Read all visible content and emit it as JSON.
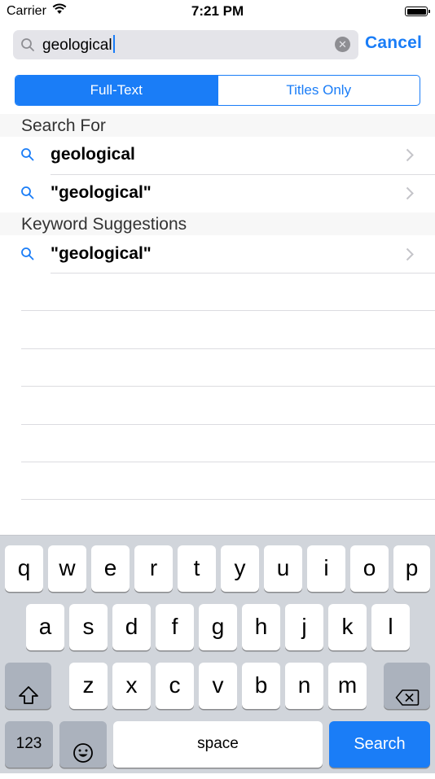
{
  "status_bar": {
    "carrier": "Carrier",
    "time": "7:21 PM"
  },
  "search": {
    "query": "geological",
    "cancel_label": "Cancel"
  },
  "segmented": {
    "options": [
      "Full-Text",
      "Titles Only"
    ],
    "selected": "Full-Text"
  },
  "sections": [
    {
      "header": "Search For",
      "rows": [
        {
          "label": "geological"
        },
        {
          "label": "\"geological\""
        }
      ]
    },
    {
      "header": "Keyword Suggestions",
      "rows": [
        {
          "label": "\"geological\""
        }
      ]
    }
  ],
  "keyboard": {
    "row1": [
      "q",
      "w",
      "e",
      "r",
      "t",
      "y",
      "u",
      "i",
      "o",
      "p"
    ],
    "row2": [
      "a",
      "s",
      "d",
      "f",
      "g",
      "h",
      "j",
      "k",
      "l"
    ],
    "row3": [
      "z",
      "x",
      "c",
      "v",
      "b",
      "n",
      "m"
    ],
    "numbers_label": "123",
    "space_label": "space",
    "search_label": "Search"
  },
  "colors": {
    "accent": "#1a7df7",
    "keyboard_bg": "#d1d5db"
  }
}
